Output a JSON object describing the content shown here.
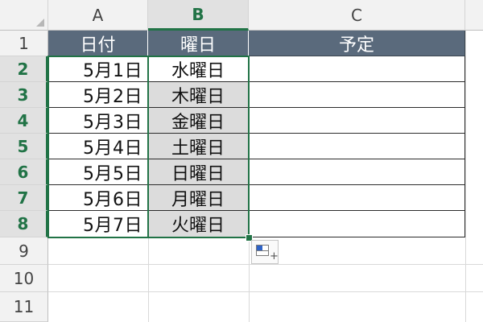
{
  "columns": {
    "a": "A",
    "b": "B",
    "c": "C"
  },
  "rows": [
    "1",
    "2",
    "3",
    "4",
    "5",
    "6",
    "7",
    "8",
    "9",
    "10",
    "11"
  ],
  "headers": {
    "date": "日付",
    "weekday": "曜日",
    "plan": "予定"
  },
  "dates": [
    "5月1日",
    "5月2日",
    "5月3日",
    "5月4日",
    "5月5日",
    "5月6日",
    "5月7日"
  ],
  "weekdays": [
    "水曜日",
    "木曜日",
    "金曜日",
    "土曜日",
    "日曜日",
    "月曜日",
    "火曜日"
  ],
  "colors": {
    "accent": "#217346",
    "header_fill": "#5a6a7c",
    "selected_fill": "#dcdcdc"
  },
  "icons": {
    "autofill_options": "autofill-options-icon"
  }
}
